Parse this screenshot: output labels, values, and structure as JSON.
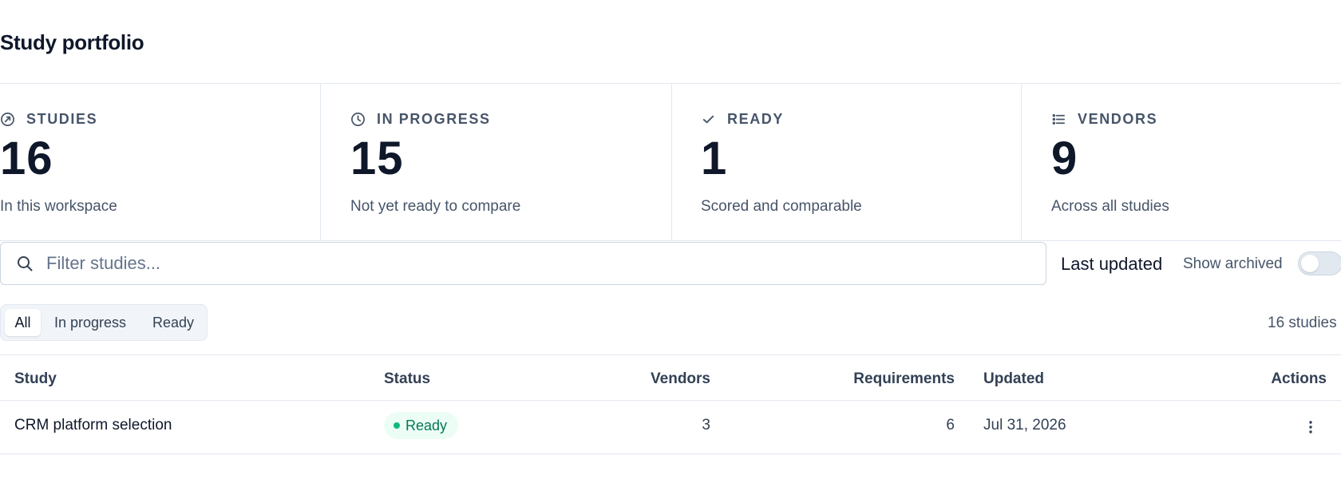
{
  "page": {
    "title": "Study portfolio"
  },
  "stats": [
    {
      "label": "STUDIES",
      "value": "16",
      "sub": "In this workspace",
      "icon": "compass-icon"
    },
    {
      "label": "IN PROGRESS",
      "value": "15",
      "sub": "Not yet ready to compare",
      "icon": "clock-icon"
    },
    {
      "label": "READY",
      "value": "1",
      "sub": "Scored and comparable",
      "icon": "check-icon"
    },
    {
      "label": "VENDORS",
      "value": "9",
      "sub": "Across all studies",
      "icon": "list-icon"
    }
  ],
  "toolbar": {
    "search_placeholder": "Filter studies...",
    "search_value": "",
    "sort_label": "Last updated",
    "archived_label": "Show archived",
    "archived_on": false
  },
  "filters": {
    "tabs": [
      "All",
      "In progress",
      "Ready"
    ],
    "active": "All",
    "count_text": "16 studies"
  },
  "table": {
    "headers": {
      "study": "Study",
      "status": "Status",
      "vendors": "Vendors",
      "requirements": "Requirements",
      "updated": "Updated",
      "actions": "Actions"
    },
    "rows": [
      {
        "study": "CRM platform selection",
        "status": "Ready",
        "vendors": "3",
        "requirements": "6",
        "updated": "Jul 31, 2026",
        "actions_icon": "more-vertical-icon"
      }
    ]
  },
  "colors": {
    "ready_badge_bg": "#ecfdf5",
    "ready_badge_text": "#047857",
    "ready_dot": "#10b981",
    "border": "#e2e8f0"
  }
}
